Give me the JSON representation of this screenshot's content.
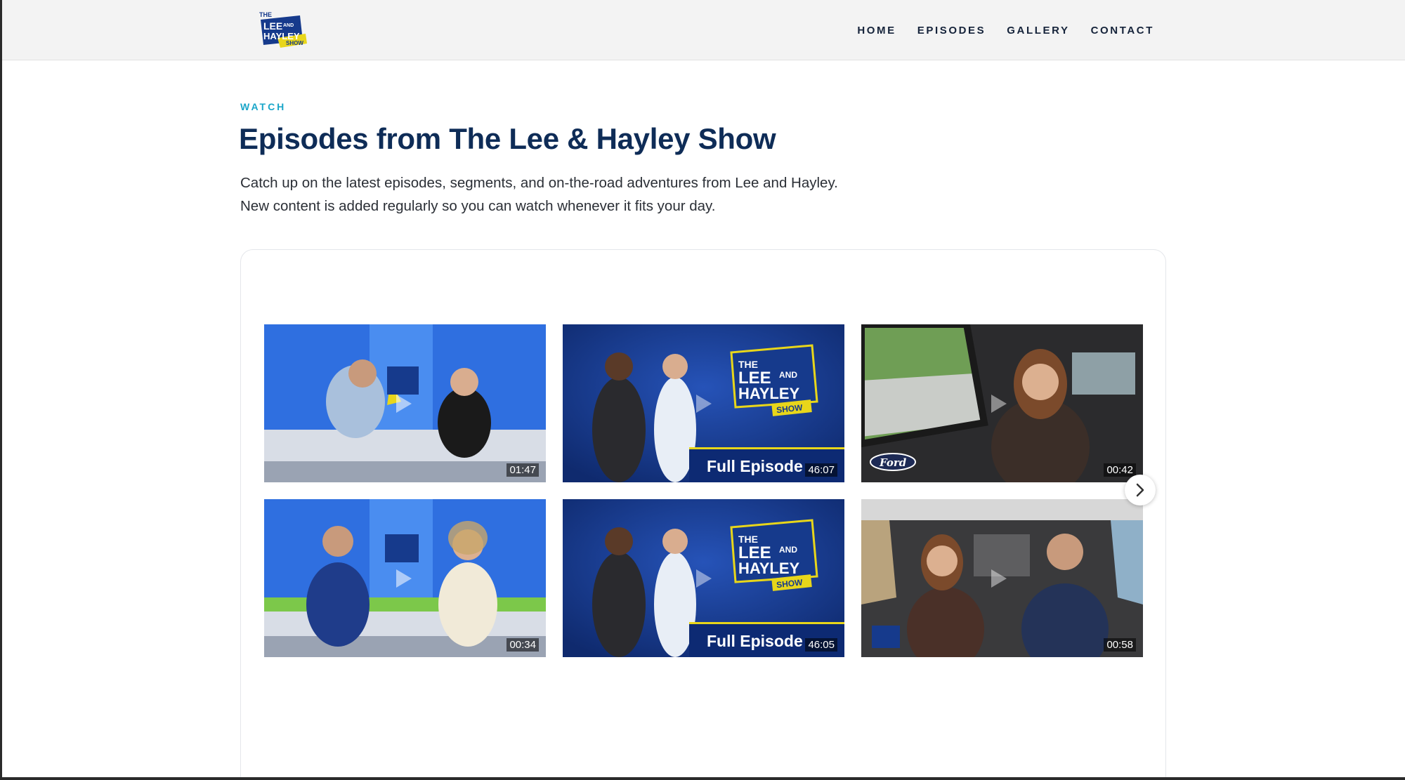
{
  "header": {
    "logo_lines": [
      "THE",
      "LEE",
      "AND",
      "HAYLEY",
      "SHOW"
    ],
    "nav": [
      "HOME",
      "EPISODES",
      "GALLERY",
      "CONTACT"
    ]
  },
  "hero": {
    "eyebrow": "WATCH",
    "title": "Episodes from The Lee & Hayley Show",
    "intro_line1": "Catch up on the latest episodes, segments, and on-the-road adventures from Lee and Hayley.",
    "intro_line2": "New content is added regularly so you can watch whenever it fits your day."
  },
  "videos": [
    {
      "duration": "01:47",
      "scene": "studio-desk"
    },
    {
      "duration": "46:07",
      "scene": "full-episode-promo",
      "banner": "Full Episode",
      "logo_lines": [
        "THE",
        "LEE",
        "AND",
        "HAYLEY",
        "SHOW"
      ]
    },
    {
      "duration": "00:42",
      "scene": "car-interior",
      "brand": "Ford"
    },
    {
      "duration": "00:34",
      "scene": "studio-desk"
    },
    {
      "duration": "46:05",
      "scene": "full-episode-promo",
      "banner": "Full Episode",
      "logo_lines": [
        "THE",
        "LEE",
        "AND",
        "HAYLEY",
        "SHOW"
      ]
    },
    {
      "duration": "00:58",
      "scene": "car-duo"
    }
  ],
  "carousel": {
    "next_icon": "chevron-right-icon"
  },
  "colors": {
    "brand_navy": "#0e2c57",
    "accent_cyan": "#1aa6c9",
    "logo_yellow": "#e8d61a",
    "promo_blue": "#163a8c"
  }
}
